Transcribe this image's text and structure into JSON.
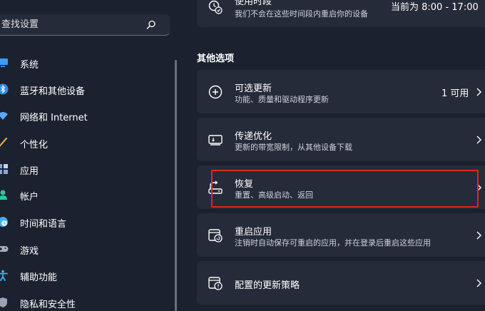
{
  "search": {
    "placeholder": "查找设置"
  },
  "sidebar": {
    "items": [
      {
        "label": "系统",
        "icon": "monitor-icon",
        "color": "#3a9bff"
      },
      {
        "label": "蓝牙和其他设备",
        "icon": "bluetooth-icon",
        "color": "#2e8cff"
      },
      {
        "label": "网络和 Internet",
        "icon": "wifi-icon",
        "color": "#58a8ff"
      },
      {
        "label": "个性化",
        "icon": "brush-icon",
        "color": "#e8a54b"
      },
      {
        "label": "应用",
        "icon": "apps-icon",
        "color": "#8aa6d6"
      },
      {
        "label": "帐户",
        "icon": "person-icon",
        "color": "#2fc59a"
      },
      {
        "label": "时间和语言",
        "icon": "globe-clock-icon",
        "color": "#3ab0ff"
      },
      {
        "label": "游戏",
        "icon": "gamepad-icon",
        "color": "#a9adb8"
      },
      {
        "label": "辅助功能",
        "icon": "accessibility-icon",
        "color": "#3ab8ff"
      },
      {
        "label": "隐私和安全性",
        "icon": "shield-icon",
        "color": "#9aa3b5"
      }
    ]
  },
  "active_hours": {
    "title": "使用时段",
    "subtitle": "我们不会在这些时间段内重启你的设备",
    "value": "当前为 8:00 - 17:00"
  },
  "other_options": {
    "heading": "其他选项",
    "cards": [
      {
        "title": "可选更新",
        "subtitle": "功能、质量和驱动程序更新",
        "value": "1 可用",
        "icon": "plus-circle-icon"
      },
      {
        "title": "传递优化",
        "subtitle": "更新的带宽限制，从其他设备下载",
        "value": "",
        "icon": "delivery-optimization-icon"
      },
      {
        "title": "恢复",
        "subtitle": "重置、高级启动、返回",
        "value": "",
        "icon": "recovery-icon"
      },
      {
        "title": "重启应用",
        "subtitle": "注销时自动保存可重启的应用，并在登录后重启这些应用",
        "value": "",
        "icon": "restart-apps-icon"
      },
      {
        "title": "配置的更新策略",
        "subtitle": "",
        "value": "",
        "icon": "update-policy-icon"
      }
    ]
  },
  "colors": {
    "background": "#1c2130",
    "card": "#262b3a",
    "highlight": "#e0242a"
  }
}
